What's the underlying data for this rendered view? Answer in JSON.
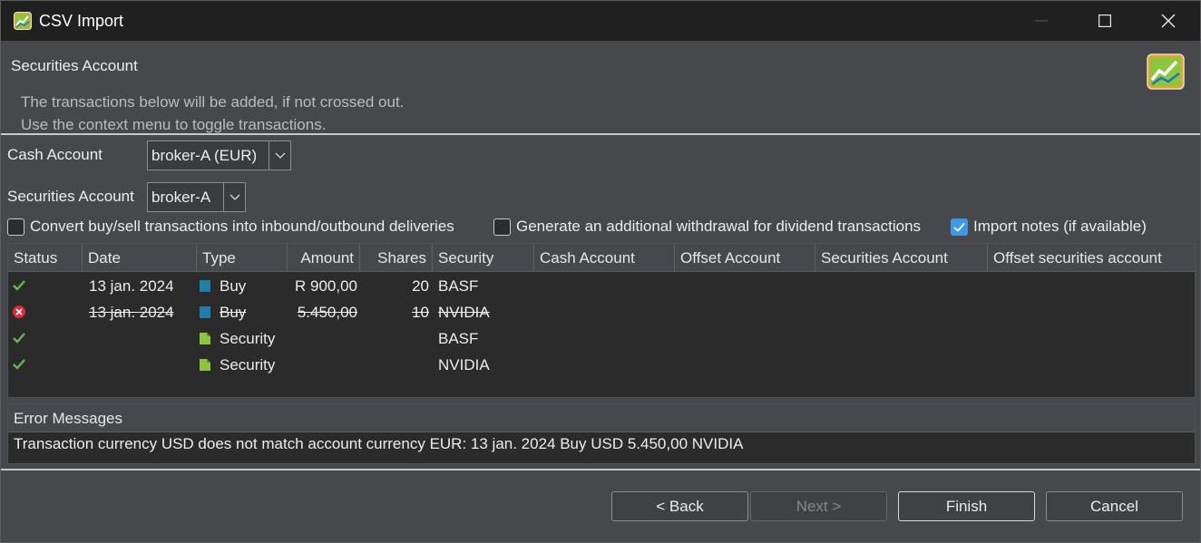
{
  "window": {
    "title": "CSV Import"
  },
  "header": {
    "title": "Securities Account",
    "desc_line1": "The transactions below will be added, if not crossed out.",
    "desc_line2": "Use the context menu to toggle transactions."
  },
  "form": {
    "cash_account_label": "Cash Account",
    "cash_account_value": "broker-A (EUR)",
    "securities_account_label": "Securities Account",
    "securities_account_value": "broker-A"
  },
  "options": [
    {
      "label": "Convert buy/sell transactions into inbound/outbound deliveries",
      "checked": false
    },
    {
      "label": "Generate an additional withdrawal for dividend transactions",
      "checked": false
    },
    {
      "label": "Import notes (if available)",
      "checked": true
    }
  ],
  "table": {
    "columns": [
      "Status",
      "Date",
      "Type",
      "Amount",
      "Shares",
      "Security",
      "Cash Account",
      "Offset Account",
      "Securities Account",
      "Offset securities account"
    ],
    "rows": [
      {
        "status": "ok",
        "date": "13 jan. 2024",
        "type": "Buy",
        "type_icon": "buy-icon",
        "amount": "R 900,00",
        "shares": "20",
        "security": "BASF",
        "crossed": false
      },
      {
        "status": "error",
        "date": "13 jan. 2024",
        "type": "Buy",
        "type_icon": "buy-icon",
        "amount": "5.450,00",
        "shares": "10",
        "security": "NVIDIA",
        "crossed": true
      },
      {
        "status": "ok",
        "date": "",
        "type": "Security",
        "type_icon": "security-icon",
        "amount": "",
        "shares": "",
        "security": "BASF",
        "crossed": false
      },
      {
        "status": "ok",
        "date": "",
        "type": "Security",
        "type_icon": "security-icon",
        "amount": "",
        "shares": "",
        "security": "NVIDIA",
        "crossed": false
      }
    ]
  },
  "errors": {
    "title": "Error Messages",
    "message": "Transaction currency USD does not match account currency EUR: 13 jan. 2024 Buy USD 5.450,00 NVIDIA"
  },
  "buttons": {
    "back": "< Back",
    "next": "Next >",
    "finish": "Finish",
    "cancel": "Cancel"
  },
  "colors": {
    "ok": "#5bbd4f",
    "error": "#e0263a",
    "buy_icon": "#1f7fa8",
    "security_icon": "#8cc63f",
    "accent": "#3d9ae8"
  }
}
